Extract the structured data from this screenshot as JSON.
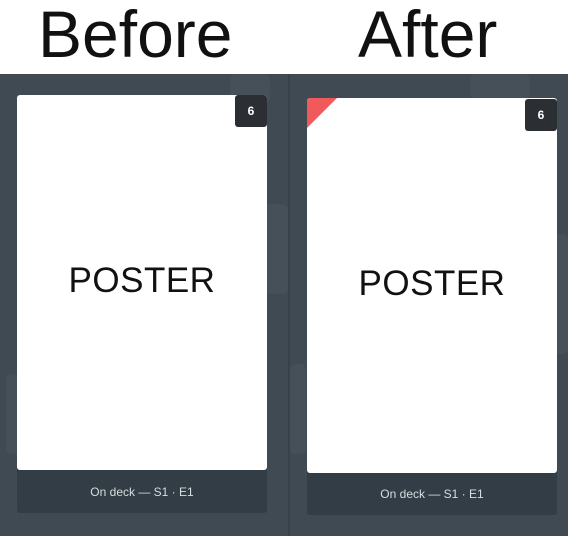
{
  "comparison": {
    "before_label": "Before",
    "after_label": "After"
  },
  "before_card": {
    "poster_label": "POSTER",
    "badge_count": "6",
    "caption": "On deck — S1 · E1"
  },
  "after_card": {
    "poster_label": "POSTER",
    "badge_count": "6",
    "caption": "On deck — S1 · E1",
    "unwatched_indicator_color": "#f15a5a"
  },
  "colors": {
    "background": "#3f4a52",
    "card_footer": "#323d45",
    "badge": "#2b2f33",
    "accent_red": "#f15a5a"
  }
}
